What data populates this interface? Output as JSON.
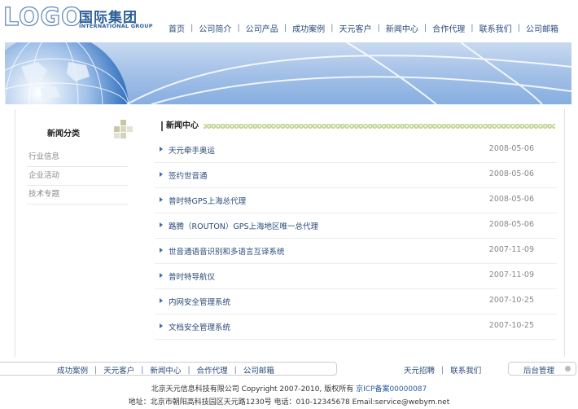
{
  "brand": {
    "logo_text": "LOGO",
    "name_cn": "国际集团",
    "name_en": "INTERNATIONAL GROUP"
  },
  "nav": [
    "首页",
    "公司简介",
    "公司产品",
    "成功案例",
    "天元客户",
    "新闻中心",
    "合作代理",
    "联系我们",
    "公司邮箱"
  ],
  "sidebar": {
    "title": "新闻分类",
    "items": [
      "行业信息",
      "企业活动",
      "技术专题"
    ]
  },
  "news": {
    "title": "新闻中心",
    "items": [
      {
        "title": "天元牵手奥运",
        "date": "2008-05-06"
      },
      {
        "title": "签约世音通",
        "date": "2008-05-06"
      },
      {
        "title": "普时特GPS上海总代理",
        "date": "2008-05-06"
      },
      {
        "title": "路腾（ROUTON）GPS上海地区唯一总代理",
        "date": "2008-05-06"
      },
      {
        "title": "世音通语音识别和多语言互译系统",
        "date": "2007-11-09"
      },
      {
        "title": "普时特导航仪",
        "date": "2007-11-09"
      },
      {
        "title": "内网安全管理系统",
        "date": "2007-10-25"
      },
      {
        "title": "文档安全管理系统",
        "date": "2007-10-25"
      }
    ]
  },
  "footer_nav": {
    "left": [
      "成功案例",
      "天元客户",
      "新闻中心",
      "合作代理",
      "公司邮箱"
    ],
    "right": [
      "天元招聘",
      "联系我们"
    ],
    "admin": "后台管理"
  },
  "copyright": {
    "line1": "北京天元信息科技有限公司 Copyright  2007-2010, 版权所有",
    "icp": "京ICP备案00000087",
    "line2": "地址：北京市朝阳高科技园区天元路1230号   电话：010-12345678   Email:service@webym.net"
  },
  "colors": {
    "accent": "#2a4a78",
    "brand": "#2d5f98",
    "banner": "#a7c3e8"
  }
}
